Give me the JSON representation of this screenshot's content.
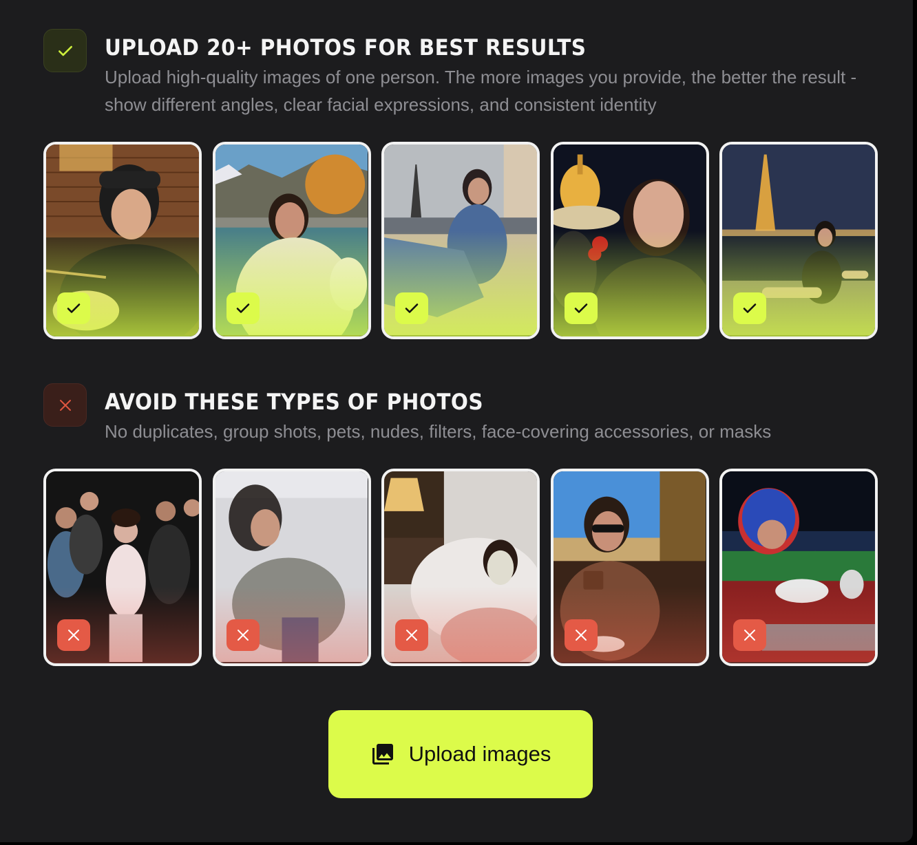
{
  "good_section": {
    "title": "UPLOAD 20+ PHOTOS FOR BEST RESULTS",
    "description": "Upload high-quality images of one person. The more images you provide, the better the result - show different angles, clear facial expressions, and consistent identity",
    "icon": "check-icon",
    "accent": "#dcfb4a",
    "photos": [
      {
        "scene": "woman in black cap eating noodles at brick wall restaurant"
      },
      {
        "scene": "woman in cream coat sitting by lake with mountains and autumn tree"
      },
      {
        "scene": "woman in denim sitting by Seine with Eiffel Tower"
      },
      {
        "scene": "woman selfie at night carnival with carousel"
      },
      {
        "scene": "woman in black dress posing with lit Eiffel Tower at night"
      }
    ]
  },
  "bad_section": {
    "title": "AVOID THESE TYPES OF PHOTOS",
    "description": "No duplicates, group shots, pets, nudes, filters, face-covering accessories, or masks",
    "icon": "x-icon",
    "accent": "#e45a46",
    "photos": [
      {
        "scene": "group shot at night party"
      },
      {
        "scene": "blurry woman in grey sweater"
      },
      {
        "scene": "woman in bed wearing face mask"
      },
      {
        "scene": "woman with sunglasses drinking coffee"
      },
      {
        "scene": "person in racing helmet in go-kart"
      }
    ]
  },
  "upload_button": {
    "label": "Upload images",
    "icon": "photo-library-icon"
  }
}
